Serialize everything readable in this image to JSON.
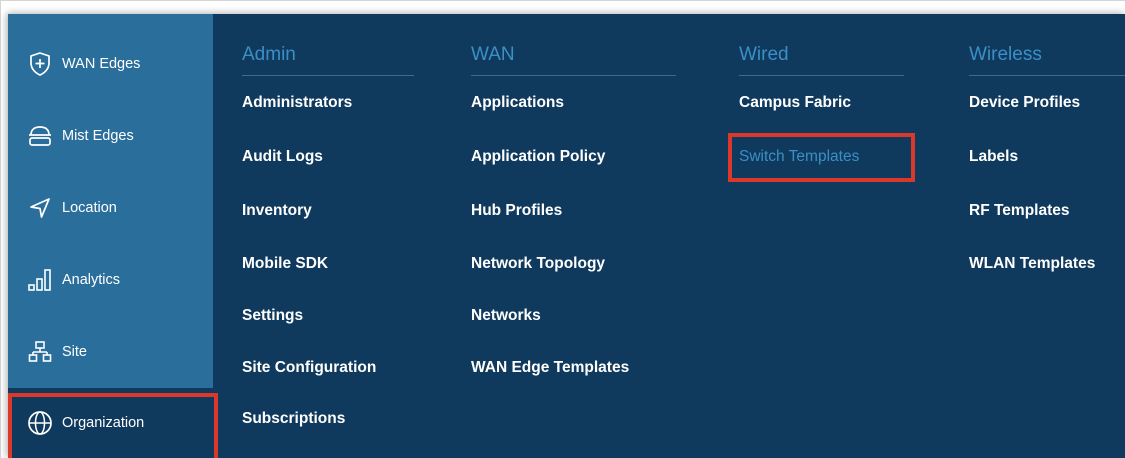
{
  "sidebar": {
    "items": [
      {
        "label": "WAN Edges",
        "icon": "shield-plus-icon"
      },
      {
        "label": "Mist Edges",
        "icon": "mist-edge-icon"
      },
      {
        "label": "Location",
        "icon": "location-arrow-icon"
      },
      {
        "label": "Analytics",
        "icon": "analytics-bars-icon"
      },
      {
        "label": "Site",
        "icon": "site-hierarchy-icon"
      },
      {
        "label": "Organization",
        "icon": "globe-icon",
        "active": true
      }
    ]
  },
  "menu": {
    "admin": {
      "heading": "Admin",
      "items": [
        "Administrators",
        "Audit Logs",
        "Inventory",
        "Mobile SDK",
        "Settings",
        "Site Configuration",
        "Subscriptions"
      ]
    },
    "wan": {
      "heading": "WAN",
      "items": [
        "Applications",
        "Application Policy",
        "Hub Profiles",
        "Network Topology",
        "Networks",
        "WAN Edge Templates"
      ]
    },
    "wired": {
      "heading": "Wired",
      "items": [
        "Campus Fabric",
        "Switch Templates"
      ],
      "highlighted": "Switch Templates"
    },
    "wireless": {
      "heading": "Wireless",
      "items": [
        "Device Profiles",
        "Labels",
        "RF Templates",
        "WLAN Templates"
      ]
    }
  },
  "colors": {
    "sidebar_bg": "#2a6e9c",
    "menu_bg": "#0f3a5d",
    "heading_accent": "#3b8fc6",
    "highlight_box": "#d9382b"
  }
}
